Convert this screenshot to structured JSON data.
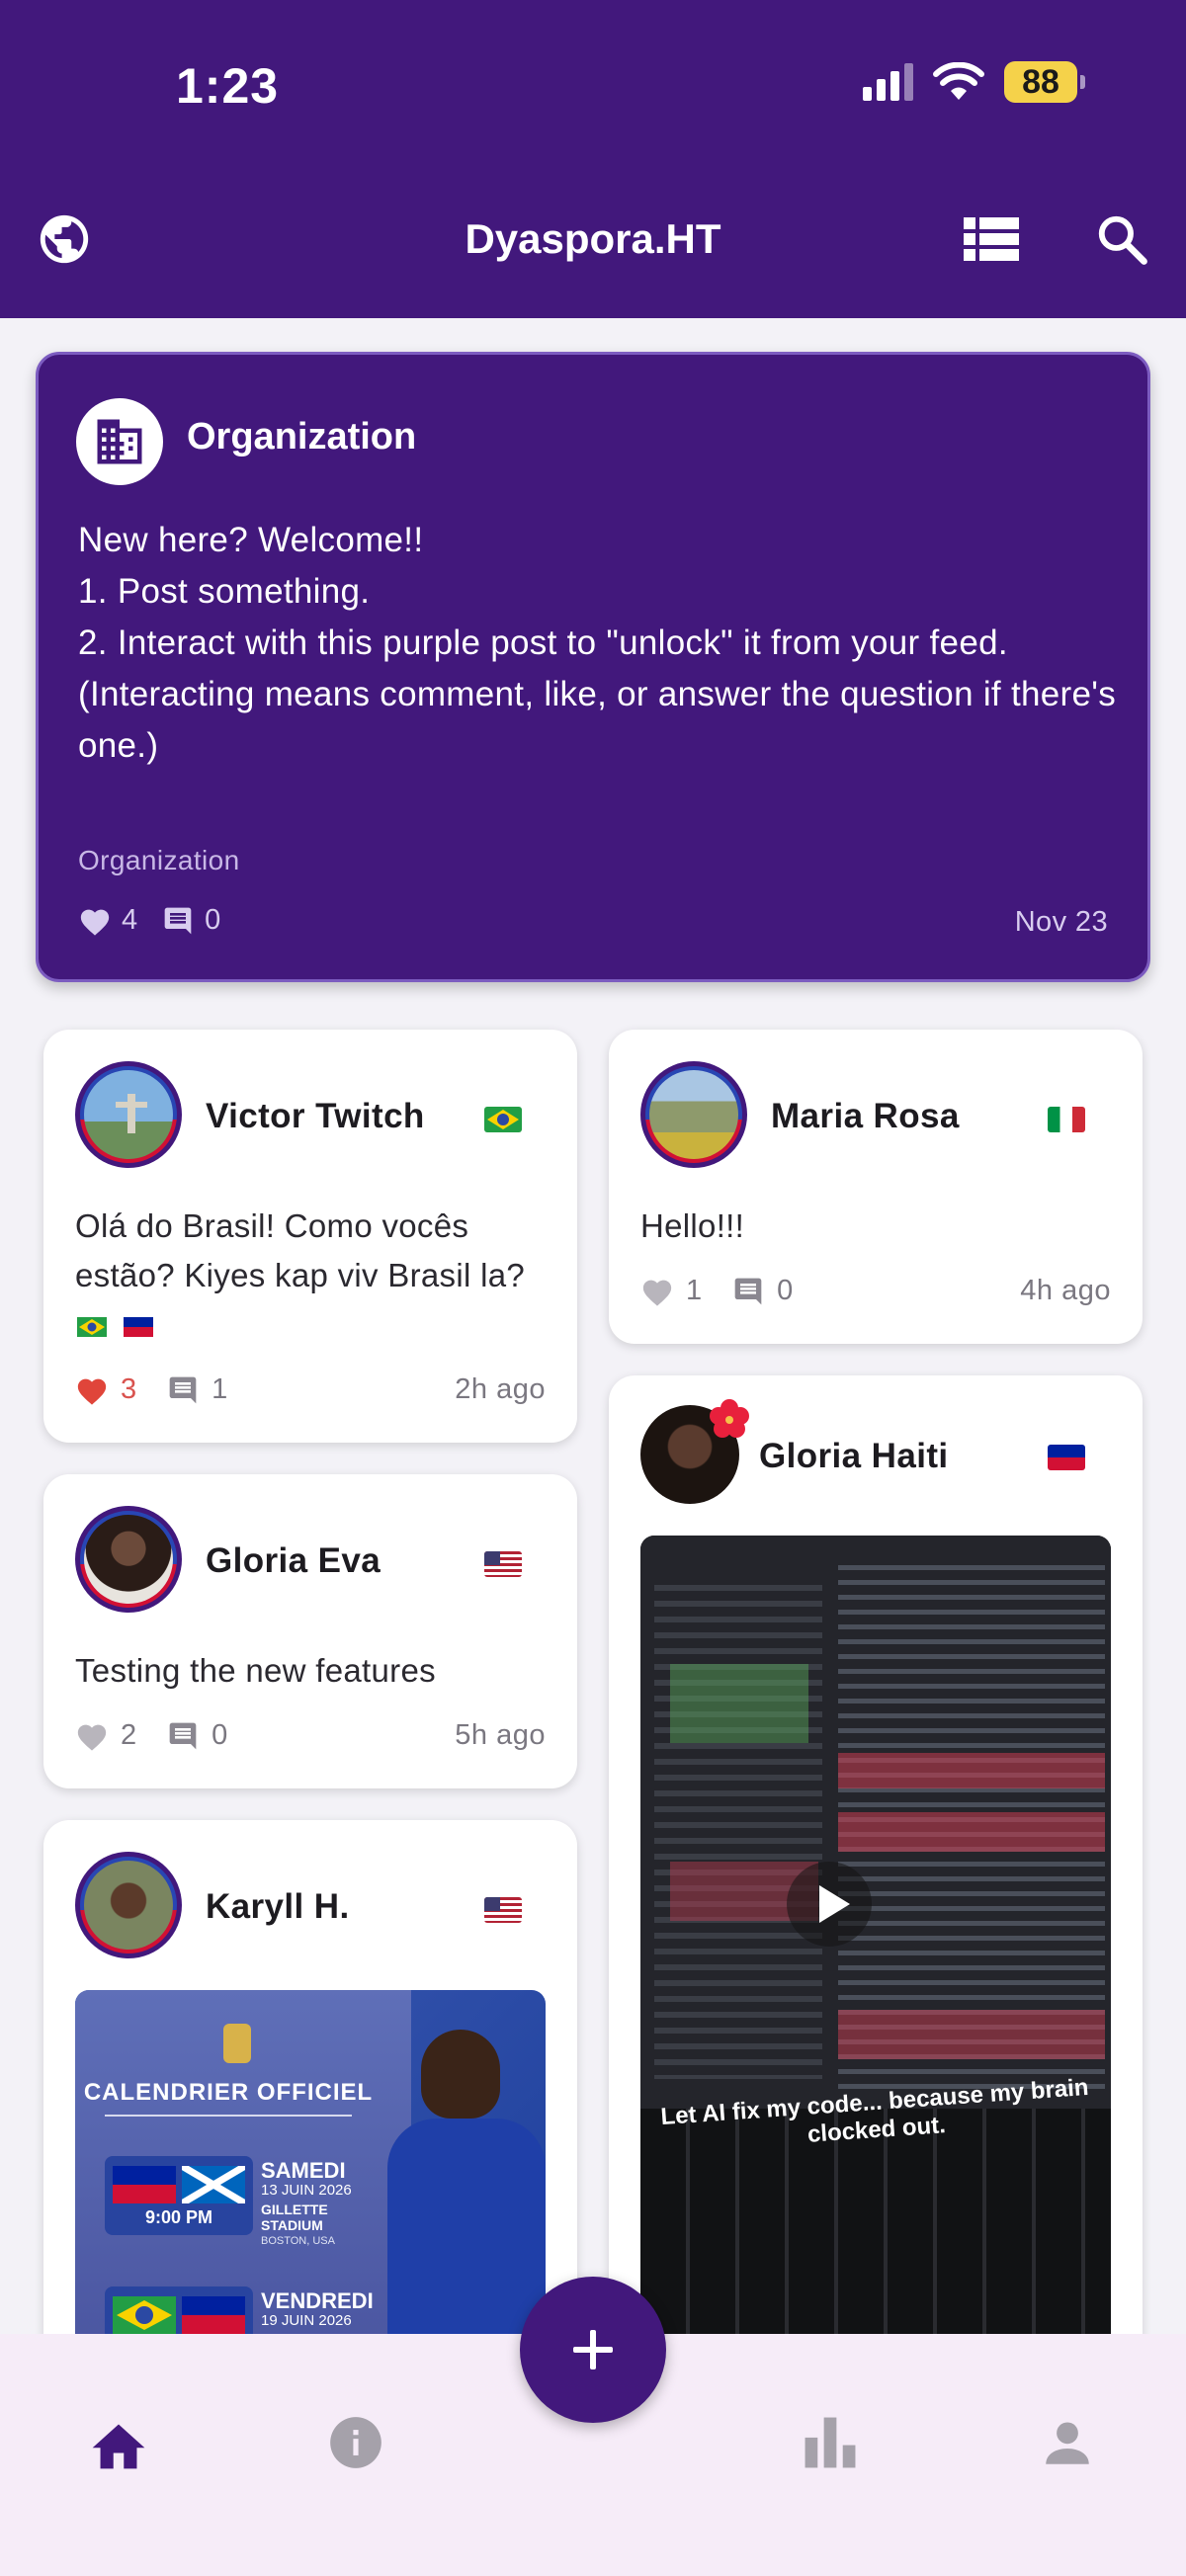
{
  "status_bar": {
    "time": "1:23",
    "battery": "88"
  },
  "app_bar": {
    "title": "Dyaspora.HT",
    "icons": [
      "globe-icon",
      "list-view-icon",
      "search-icon"
    ]
  },
  "featured_post": {
    "author": "Organization",
    "icon": "building-icon",
    "body": "New here? Welcome!!\n1. Post something.\n2. Interact with this purple post to \"unlock\" it from your feed.\n(Interacting means comment, like, or answer the question if there's one.)",
    "category": "Organization",
    "likes": "4",
    "comments": "0",
    "date": "Nov 23"
  },
  "posts": [
    {
      "author": "Victor Twitch",
      "flag": "brazil",
      "text": "Olá do Brasil! Como vocês estão? Kiyes kap viv Brasil la?",
      "likes": "3",
      "liked": true,
      "comments": "1",
      "time": "2h ago"
    },
    {
      "author": "Maria Rosa",
      "flag": "italy",
      "text": "Hello!!!",
      "likes": "1",
      "comments": "0",
      "time": "4h ago"
    },
    {
      "author": "Gloria Eva",
      "flag": "usa",
      "text": "Testing the new features",
      "likes": "2",
      "comments": "0",
      "time": "5h ago"
    },
    {
      "author": "Gloria Haiti",
      "flag": "haiti",
      "media": "video",
      "caption": "Let AI fix my code... because my brain clocked out."
    },
    {
      "author": "Karyll H.",
      "flag": "usa",
      "media": "image",
      "poster": {
        "title": "CALENDRIER OFFICIEL",
        "day1": "SAMEDI",
        "date1": "13 JUIN 2026",
        "venue1": "GILLETTE STADIUM",
        "city1": "BOSTON, USA",
        "time1": "9:00 PM",
        "day2": "VENDREDI",
        "date2": "19 JUIN 2026"
      }
    }
  ],
  "bottom_nav": {
    "items": [
      "home-icon",
      "info-icon",
      "add-icon",
      "stats-icon",
      "profile-icon"
    ],
    "active": "home-icon"
  },
  "colors": {
    "brand": "#42187c",
    "like": "#d9534f",
    "nav_bg": "#f6ecf8"
  }
}
